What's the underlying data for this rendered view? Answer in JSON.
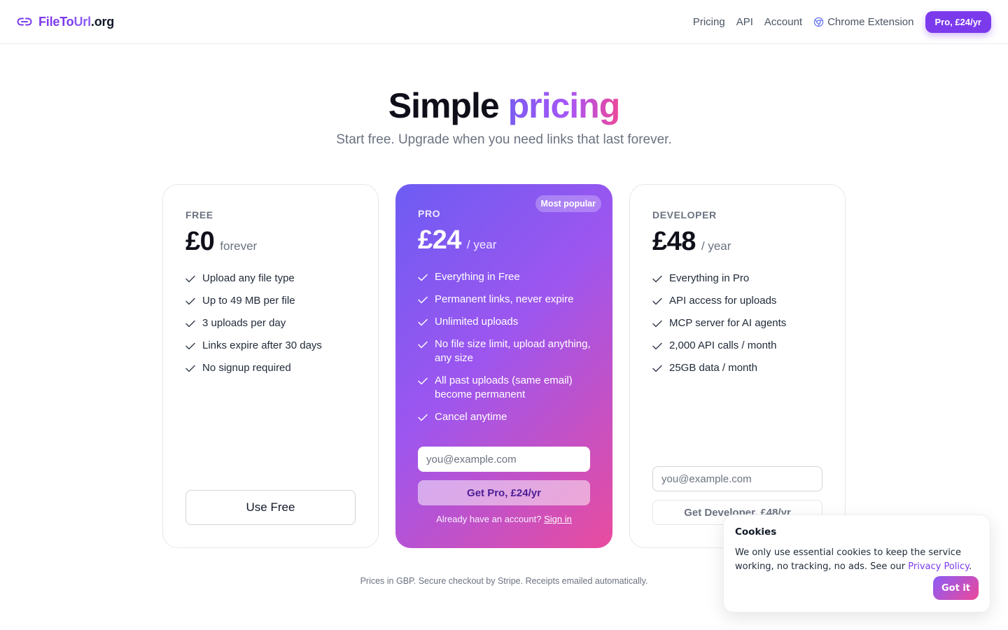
{
  "header": {
    "brand": {
      "part1": "File",
      "part2": "To",
      "part3": "Url",
      "part4": ".org",
      "icon": "link-icon"
    },
    "nav": {
      "pricing": "Pricing",
      "api": "API",
      "account": "Account",
      "chrome_extension": "Chrome Extension",
      "chrome_icon": "chrome-icon",
      "cta": "Pro, £24/yr"
    }
  },
  "hero": {
    "title_plain": "Simple",
    "title_accent": "pricing",
    "subtitle": "Start free. Upgrade when you need links that last forever."
  },
  "plans": {
    "free": {
      "label": "FREE",
      "price": "£0",
      "period": "forever",
      "features": [
        "Upload any file type",
        "Up to 49 MB per file",
        "3 uploads per day",
        "Links expire after 30 days",
        "No signup required"
      ],
      "button": "Use Free"
    },
    "pro": {
      "badge": "Most popular",
      "label": "PRO",
      "price": "£24",
      "period": "/ year",
      "features": [
        "Everything in Free",
        "Permanent links, never expire",
        "Unlimited uploads",
        "No file size limit, upload anything, any size",
        "All past uploads (same email) become permanent",
        "Cancel anytime"
      ],
      "email_placeholder": "you@example.com",
      "button": "Get Pro, £24/yr",
      "already_text": "Already have an account?",
      "signin": "Sign in"
    },
    "developer": {
      "label": "DEVELOPER",
      "price": "£48",
      "period": "/ year",
      "features": [
        "Everything in Pro",
        "API access for uploads",
        "MCP server for AI agents",
        "2,000 API calls / month",
        "25GB data / month"
      ],
      "email_placeholder": "you@example.com",
      "button": "Get Developer, £48/yr"
    }
  },
  "footnote": "Prices in GBP. Secure checkout by Stripe. Receipts emailed automatically.",
  "cookie": {
    "title": "Cookies",
    "text": "We only use essential cookies to keep the service working, no tracking, no ads. See our",
    "link": "Privacy Policy",
    "suffix": ".",
    "button": "Got it"
  },
  "colors": {
    "accent": "#7c3aed",
    "pink": "#ec4899",
    "text": "#111827",
    "muted": "#6b7280"
  }
}
